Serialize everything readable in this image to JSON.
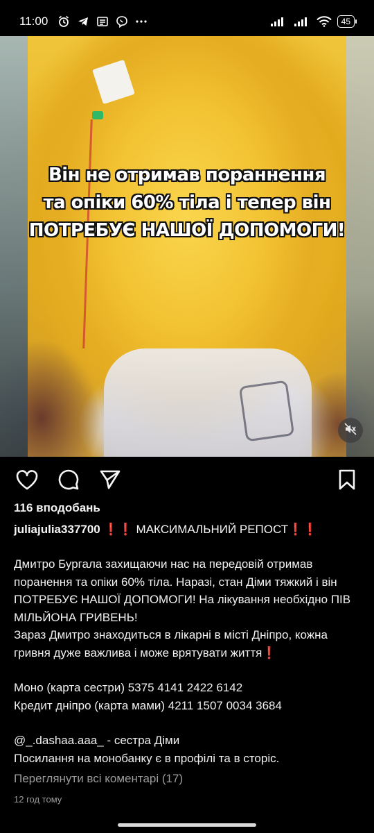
{
  "status_bar": {
    "time": "11:00",
    "icons": [
      "alarm-icon",
      "telegram-icon",
      "news-icon",
      "viber-icon",
      "more-dots-icon"
    ],
    "right_icons": [
      "signal-icon",
      "signal-icon",
      "wifi-icon"
    ],
    "battery": "45"
  },
  "media": {
    "overlay_lines": [
      "Він не отримав пораннення",
      "та опіки 60% тіла і тепер він",
      "ПОТРЕБУЄ НАШОЇ ДОПОМОГИ!"
    ],
    "mute_icon": "speaker-muted-icon"
  },
  "actions": {
    "like_icon": "heart-icon",
    "comment_icon": "comment-icon",
    "share_icon": "send-icon",
    "save_icon": "bookmark-icon"
  },
  "post": {
    "likes": "116 вподобань",
    "username": "juliajulia337700",
    "headline_prefix": "❗❗",
    "headline": " МАКСИМАЛЬНИЙ РЕПОСТ",
    "headline_suffix": "❗❗",
    "paragraph1": "Дмитро Бургала захищаючи нас на передовій отримав поранення та опіки 60% тіла. Наразі, стан Діми тяжкий і він ПОТРЕБУЄ НАШОЇ ДОПОМОГИ! На лікування необхідно ПІВ МІЛЬЙОНА ГРИВЕНЬ!",
    "paragraph2": "Зараз Дмитро знаходиться в лікарні в місті Дніпро, кожна гривня дуже важлива і може врятувати життя",
    "paragraph2_mark": "❗",
    "card1": "Моно (карта сестри) 5375 4141 2422 6142",
    "card2": "Кредит дніпро (карта мами) 4211 1507 0034 3684",
    "mention": "@_.dashaa.aaa_ - сестра Діми",
    "note": "Посилання на монобанку є в профілі та в сторіс.",
    "view_comments": "Переглянути всі коментарі (17)",
    "time_ago": "12 год тому"
  }
}
